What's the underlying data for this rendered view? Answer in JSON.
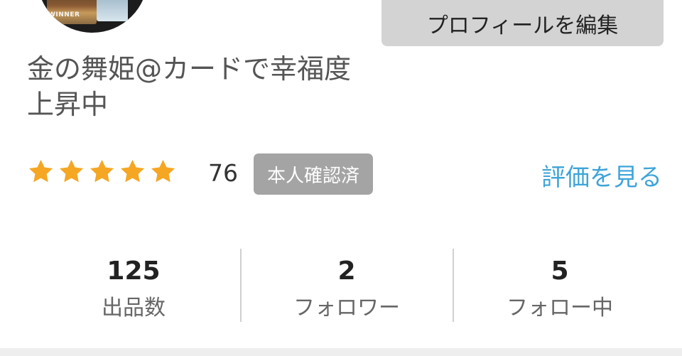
{
  "profile": {
    "avatar_text": "WINNER",
    "edit_button_label": "プロフィールを編集",
    "name": "金の舞姫@カードで幸福度上昇中",
    "rating": {
      "stars": 5,
      "max_stars": 5,
      "count": "76"
    },
    "verified_badge": "本人確認済",
    "reviews_link": "評価を見る"
  },
  "stats": [
    {
      "value": "125",
      "label": "出品数"
    },
    {
      "value": "2",
      "label": "フォロワー"
    },
    {
      "value": "5",
      "label": "フォロー中"
    }
  ],
  "colors": {
    "star": "#f5a623",
    "link": "#3ea4d8",
    "badge_bg": "#a4a4a4",
    "button_bg": "#d3d3d3"
  },
  "icons": {
    "star": "star-icon"
  }
}
